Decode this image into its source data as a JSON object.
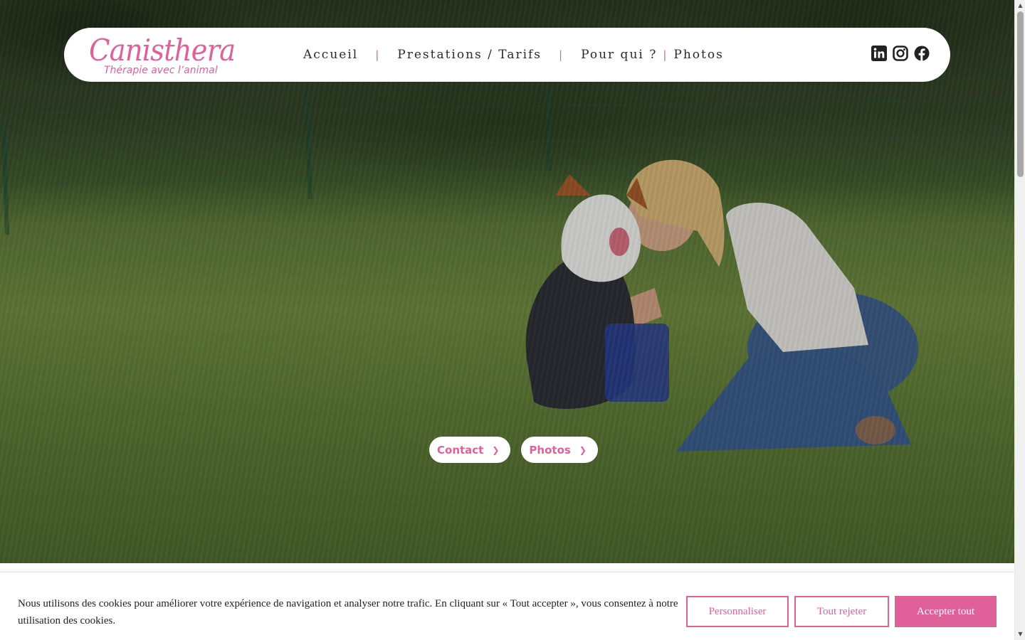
{
  "brand": {
    "name": "Canisthera",
    "tagline": "Thérapie avec l’animal",
    "accent_color": "#e0609a"
  },
  "nav": {
    "items": [
      {
        "label": "Accueil"
      },
      {
        "label": "Prestations / Tarifs"
      },
      {
        "label": "Pour qui ?"
      },
      {
        "label": "Photos"
      }
    ],
    "separator": "|"
  },
  "social": {
    "icons": [
      "linkedin-icon",
      "instagram-icon",
      "facebook-icon"
    ]
  },
  "hero": {
    "image_description_icon": "hero-photo",
    "buttons": [
      {
        "label": "Contact",
        "icon": "chevron-right-icon"
      },
      {
        "label": "Photos",
        "icon": "chevron-right-icon"
      }
    ]
  },
  "cookie_banner": {
    "text": "Nous utilisons des cookies pour améliorer votre expérience de navigation et analyser notre trafic. En cliquant sur « Tout accepter », vous consentez à notre utilisation des cookies.",
    "customize_label": "Personnaliser",
    "reject_label": "Tout rejeter",
    "accept_label": "Accepter tout"
  }
}
